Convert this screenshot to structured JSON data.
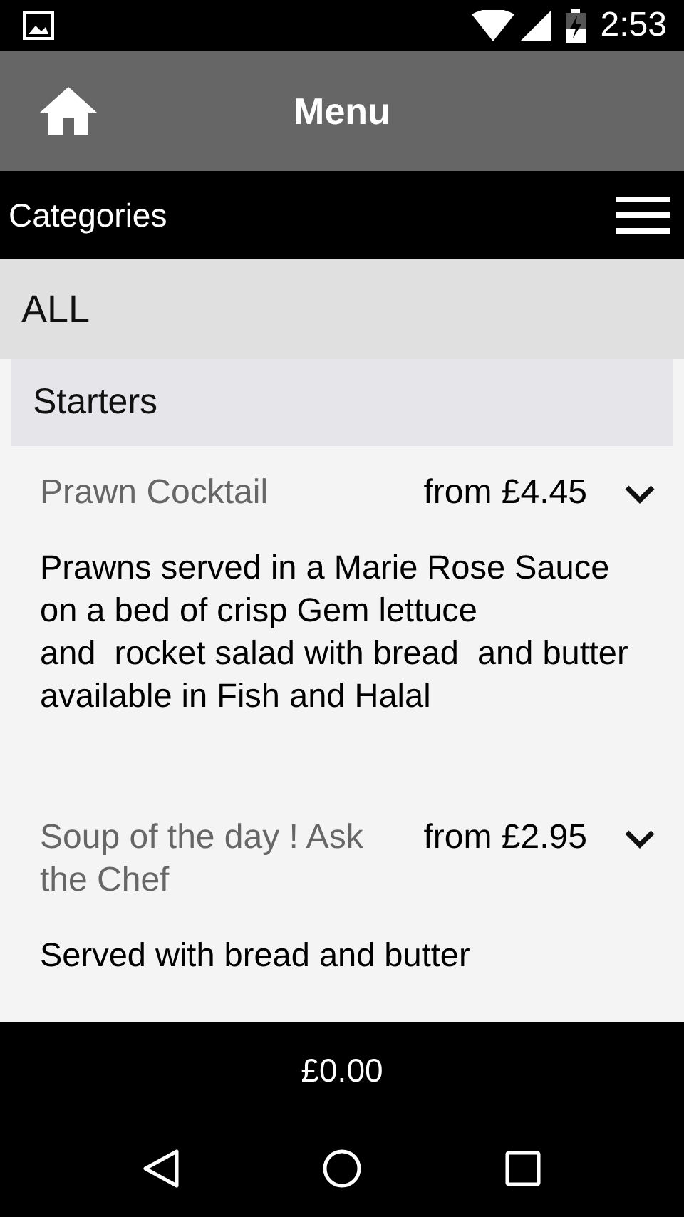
{
  "status_bar": {
    "time": "2:53"
  },
  "app_bar": {
    "title": "Menu"
  },
  "categories_bar": {
    "label": "Categories"
  },
  "category": {
    "label": "ALL"
  },
  "section": {
    "label": "Starters"
  },
  "items": [
    {
      "name": "Prawn Cocktail",
      "price": "from £4.45",
      "description": "Prawns served in a Marie Rose Sauce on a bed of crisp Gem lettuce\nand  rocket salad with bread  and butter\navailable in Fish and Halal"
    },
    {
      "name": "Soup of the day ! Ask the Chef",
      "price": "from £2.95",
      "description": "Served with bread and butter"
    }
  ],
  "total": "£0.00"
}
